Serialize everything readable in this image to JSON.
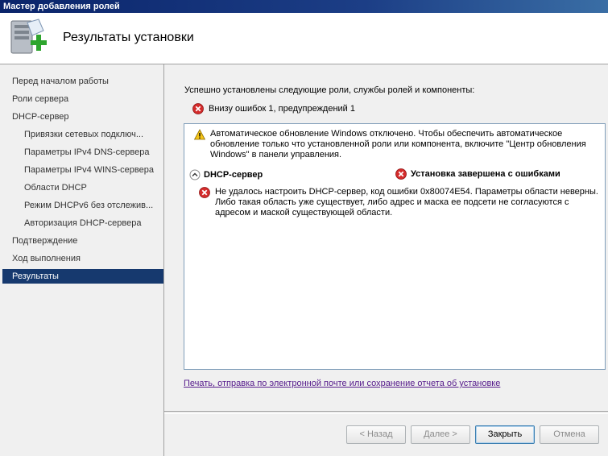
{
  "window": {
    "title": "Мастер добавления ролей"
  },
  "header": {
    "title": "Результаты установки",
    "icon": "server-add-icon"
  },
  "sidebar": {
    "items": [
      {
        "label": "Перед началом работы",
        "sub": false,
        "selected": false
      },
      {
        "label": "Роли сервера",
        "sub": false,
        "selected": false
      },
      {
        "label": "DHCP-сервер",
        "sub": false,
        "selected": false
      },
      {
        "label": "Привязки сетевых подключ...",
        "sub": true,
        "selected": false
      },
      {
        "label": "Параметры IPv4 DNS-сервера",
        "sub": true,
        "selected": false
      },
      {
        "label": "Параметры IPv4 WINS-сервера",
        "sub": true,
        "selected": false
      },
      {
        "label": "Области DHCP",
        "sub": true,
        "selected": false
      },
      {
        "label": "Режим DHCPv6 без отслежив...",
        "sub": true,
        "selected": false
      },
      {
        "label": "Авторизация DHCP-сервера",
        "sub": true,
        "selected": false
      },
      {
        "label": "Подтверждение",
        "sub": false,
        "selected": false
      },
      {
        "label": "Ход выполнения",
        "sub": false,
        "selected": false
      },
      {
        "label": "Результаты",
        "sub": false,
        "selected": true
      }
    ],
    "colors": {
      "selected_bg": "#16396e",
      "selected_fg": "#ffffff"
    }
  },
  "main": {
    "intro": "Успешно установлены следующие роли, службы ролей и компоненты:",
    "summary": "Внизу ошибок 1, предупреждений 1",
    "warning": "Автоматическое обновление Windows отключено. Чтобы обеспечить автоматическое обновление только что установленной роли или компонента, включите \"Центр обновления Windows\" в панели управления.",
    "role": {
      "name": "DHCP-сервер",
      "status": "Установка завершена с ошибками",
      "error": "Не удалось настроить DHCP-сервер, код ошибки 0x80074E54.  Параметры области неверны. Либо такая область уже существует,  либо адрес и маска ее подсети не согласуются с адресом и маской  существующей области."
    },
    "report_link": "Печать, отправка по электронной почте или сохранение отчета об установке"
  },
  "buttons": {
    "back": "< Назад",
    "next": "Далее >",
    "close": "Закрыть",
    "cancel": "Отмена"
  },
  "icons": {
    "error": "error-icon",
    "warning": "warning-icon",
    "collapse": "collapse-chevron-icon"
  },
  "colors": {
    "error_red": "#d42b2b",
    "warning_yellow": "#f5c518",
    "link": "#551a8b",
    "titlebar": "#0a246a"
  }
}
